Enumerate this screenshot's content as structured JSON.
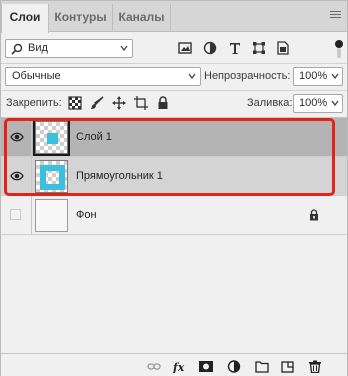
{
  "tabs": [
    {
      "label": "Слои",
      "active": true
    },
    {
      "label": "Контуры",
      "active": false
    },
    {
      "label": "Каналы",
      "active": false
    }
  ],
  "filter": {
    "kind_label": "Вид"
  },
  "blend_mode": "Обычные",
  "opacity": {
    "label": "Непрозрачность:",
    "value": "100%"
  },
  "lock": {
    "label": "Закрепить:"
  },
  "fill": {
    "label": "Заливка:",
    "value": "100%"
  },
  "layers": [
    {
      "name": "Слой 1",
      "visible": true,
      "selected": true
    },
    {
      "name": "Прямоугольник 1",
      "visible": true,
      "selected": false
    },
    {
      "name": "Фон",
      "visible": false,
      "locked": true
    }
  ],
  "colors": {
    "accent_cyan": "#3bbfdc",
    "highlight_red": "#e2231a",
    "selected_row": "#b4b4b4"
  },
  "icons": {
    "filter": [
      "image-filter-icon",
      "adjustment-filter-icon",
      "type-filter-icon",
      "shape-filter-icon",
      "smart-object-filter-icon"
    ],
    "lock": [
      "lock-transparent-pixels-icon",
      "lock-image-pixels-icon",
      "lock-position-icon",
      "lock-artboard-icon",
      "lock-all-icon"
    ],
    "bottom": [
      "link-layers-icon",
      "layer-style-icon",
      "layer-mask-icon",
      "adjustment-layer-icon",
      "group-icon",
      "new-layer-icon",
      "delete-icon"
    ]
  }
}
